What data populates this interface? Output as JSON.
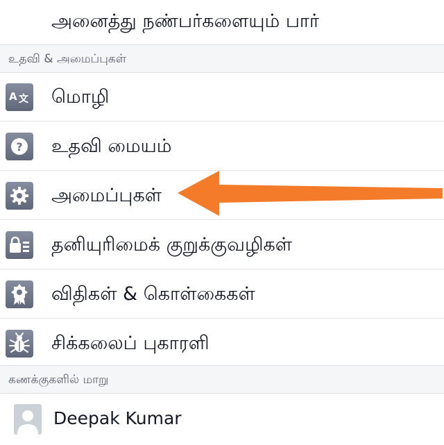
{
  "top_item": {
    "label": "அனைத்து நண்பர்களையும் பார்"
  },
  "help_section": {
    "title": "உதவி & அமைப்புகள்",
    "items": [
      {
        "label": "மொழி",
        "icon": "translate-icon"
      },
      {
        "label": "உதவி மையம்",
        "icon": "help-icon"
      },
      {
        "label": "அமைப்புகள்",
        "icon": "gear-icon"
      },
      {
        "label": "தனியுரிமைக் குறுக்குவழிகள்",
        "icon": "privacy-lock-icon"
      },
      {
        "label": "விதிகள் & கொள்கைகள்",
        "icon": "award-ribbon-icon"
      },
      {
        "label": "சிக்கலைப் புகாரளி",
        "icon": "bug-icon"
      }
    ]
  },
  "account_section": {
    "title": "கணக்குகளில் மாறு",
    "account": {
      "name": "Deepak Kumar",
      "icon": "default-avatar-icon"
    }
  },
  "annotation": {
    "icon": "orange-arrow-icon",
    "color": "#f47b2a"
  },
  "colors": {
    "section_bg": "#f5f6f8",
    "divider": "#dddfe2",
    "icon_bg": "#6d7588",
    "text": "#141823",
    "section_text": "#5d6373"
  }
}
